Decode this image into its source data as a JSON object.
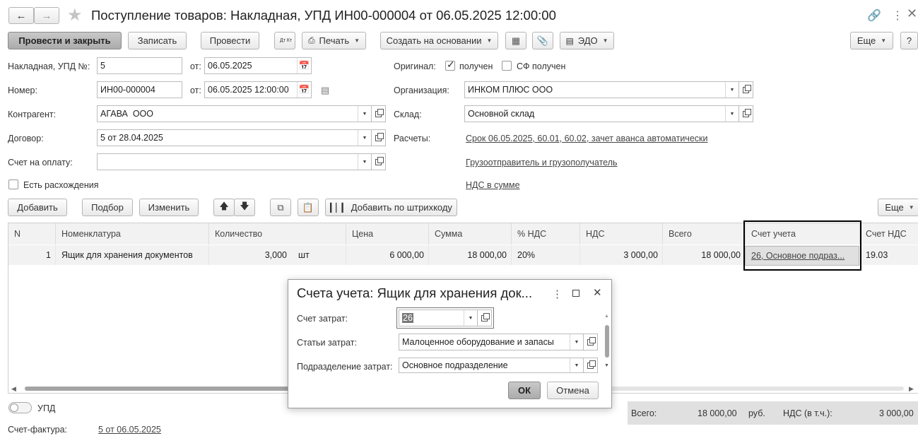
{
  "window": {
    "title": "Поступление товаров: Накладная, УПД ИН00-000004 от 06.05.2025 12:00:00"
  },
  "toolbar": {
    "post_close": "Провести и закрыть",
    "save": "Записать",
    "post": "Провести",
    "dtkt": "Дт Кт",
    "print": "Печать",
    "create_based": "Создать на основании",
    "edo": "ЭДО",
    "more": "Еще",
    "help": "?"
  },
  "header": {
    "invoice_label": "Накладная, УПД №:",
    "invoice_value": "5",
    "from_label1": "от:",
    "date1": "06.05.2025",
    "number_label": "Номер:",
    "number_value": "ИН00-000004",
    "from_label2": "от:",
    "date2": "06.05.2025 12:00:00",
    "original_label": "Оригинал:",
    "received_label": "получен",
    "sf_received_label": "СФ получен",
    "org_label": "Организация:",
    "org_value": "ИНКОМ ПЛЮС ООО",
    "counterparty_label": "Контрагент:",
    "counterparty_value": "АГАВА  ООО",
    "warehouse_label": "Склад:",
    "warehouse_value": "Основной склад",
    "contract_label": "Договор:",
    "contract_value": "5 от 28.04.2025",
    "settlements_label": "Расчеты:",
    "settlements_link": "Срок 06.05.2025, 60.01, 60.02, зачет аванса автоматически",
    "invoice_pay_label": "Счет на оплату:",
    "invoice_pay_value": "",
    "shipper_link": "Грузоотправитель и грузополучатель",
    "discrepancy_label": "Есть расхождения",
    "vat_link": "НДС в сумме"
  },
  "table_toolbar": {
    "add": "Добавить",
    "pick": "Подбор",
    "change": "Изменить",
    "barcode": "Добавить по штрихкоду",
    "more": "Еще"
  },
  "table": {
    "columns": [
      "N",
      "Номенклатура",
      "Количество",
      "Цена",
      "Сумма",
      "% НДС",
      "НДС",
      "Всего",
      "Счет учета",
      "Счет НДС"
    ],
    "rows": [
      {
        "n": "1",
        "name": "Ящик для хранения документов",
        "qty": "3,000",
        "unit": "шт",
        "price": "6 000,00",
        "sum": "18 000,00",
        "vat_rate": "20%",
        "vat": "3 000,00",
        "total": "18 000,00",
        "account": "26, Основное подраз...",
        "vat_account": "19.03"
      }
    ]
  },
  "dialog": {
    "title": "Счета учета: Ящик для хранения док...",
    "cost_account_label": "Счет затрат:",
    "cost_account_value": "26",
    "cost_items_label": "Статьи затрат:",
    "cost_items_value": "Малоценное оборудование и запасы",
    "cost_dept_label": "Подразделение затрат:",
    "cost_dept_value": "Основное подразделение",
    "ok": "ОК",
    "cancel": "Отмена"
  },
  "footer": {
    "upd_label": "УПД",
    "invoice_label": "Счет-фактура:",
    "invoice_link": "5 от 06.05.2025",
    "total_label": "Всего:",
    "total_value": "18 000,00",
    "currency": "руб.",
    "vat_label": "НДС (в т.ч.):",
    "vat_value": "3 000,00"
  }
}
